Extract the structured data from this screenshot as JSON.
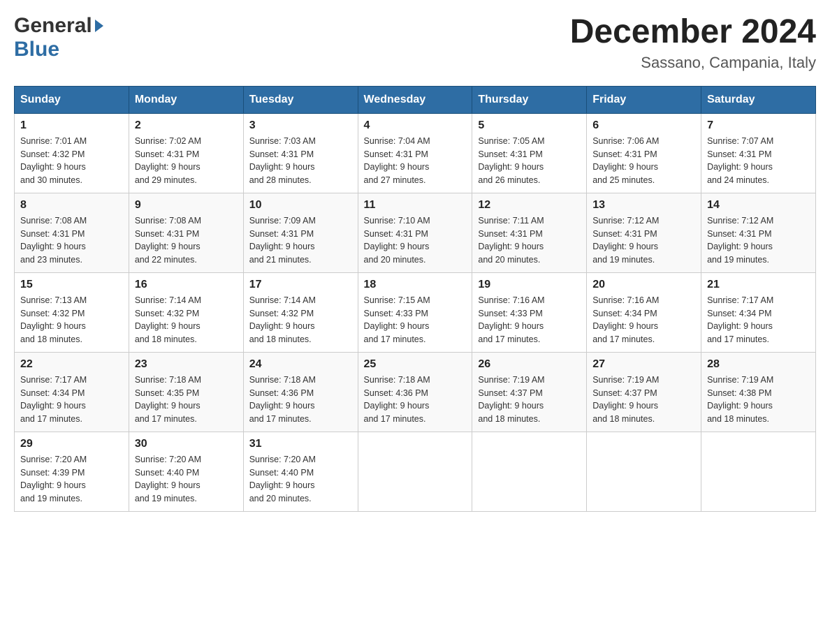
{
  "header": {
    "logo": {
      "general": "General",
      "blue": "Blue",
      "arrow": "▶"
    },
    "title": "December 2024",
    "subtitle": "Sassano, Campania, Italy"
  },
  "weekdays": [
    "Sunday",
    "Monday",
    "Tuesday",
    "Wednesday",
    "Thursday",
    "Friday",
    "Saturday"
  ],
  "weeks": [
    [
      {
        "day": "1",
        "sunrise": "7:01 AM",
        "sunset": "4:32 PM",
        "daylight": "9 hours and 30 minutes."
      },
      {
        "day": "2",
        "sunrise": "7:02 AM",
        "sunset": "4:31 PM",
        "daylight": "9 hours and 29 minutes."
      },
      {
        "day": "3",
        "sunrise": "7:03 AM",
        "sunset": "4:31 PM",
        "daylight": "9 hours and 28 minutes."
      },
      {
        "day": "4",
        "sunrise": "7:04 AM",
        "sunset": "4:31 PM",
        "daylight": "9 hours and 27 minutes."
      },
      {
        "day": "5",
        "sunrise": "7:05 AM",
        "sunset": "4:31 PM",
        "daylight": "9 hours and 26 minutes."
      },
      {
        "day": "6",
        "sunrise": "7:06 AM",
        "sunset": "4:31 PM",
        "daylight": "9 hours and 25 minutes."
      },
      {
        "day": "7",
        "sunrise": "7:07 AM",
        "sunset": "4:31 PM",
        "daylight": "9 hours and 24 minutes."
      }
    ],
    [
      {
        "day": "8",
        "sunrise": "7:08 AM",
        "sunset": "4:31 PM",
        "daylight": "9 hours and 23 minutes."
      },
      {
        "day": "9",
        "sunrise": "7:08 AM",
        "sunset": "4:31 PM",
        "daylight": "9 hours and 22 minutes."
      },
      {
        "day": "10",
        "sunrise": "7:09 AM",
        "sunset": "4:31 PM",
        "daylight": "9 hours and 21 minutes."
      },
      {
        "day": "11",
        "sunrise": "7:10 AM",
        "sunset": "4:31 PM",
        "daylight": "9 hours and 20 minutes."
      },
      {
        "day": "12",
        "sunrise": "7:11 AM",
        "sunset": "4:31 PM",
        "daylight": "9 hours and 20 minutes."
      },
      {
        "day": "13",
        "sunrise": "7:12 AM",
        "sunset": "4:31 PM",
        "daylight": "9 hours and 19 minutes."
      },
      {
        "day": "14",
        "sunrise": "7:12 AM",
        "sunset": "4:31 PM",
        "daylight": "9 hours and 19 minutes."
      }
    ],
    [
      {
        "day": "15",
        "sunrise": "7:13 AM",
        "sunset": "4:32 PM",
        "daylight": "9 hours and 18 minutes."
      },
      {
        "day": "16",
        "sunrise": "7:14 AM",
        "sunset": "4:32 PM",
        "daylight": "9 hours and 18 minutes."
      },
      {
        "day": "17",
        "sunrise": "7:14 AM",
        "sunset": "4:32 PM",
        "daylight": "9 hours and 18 minutes."
      },
      {
        "day": "18",
        "sunrise": "7:15 AM",
        "sunset": "4:33 PM",
        "daylight": "9 hours and 17 minutes."
      },
      {
        "day": "19",
        "sunrise": "7:16 AM",
        "sunset": "4:33 PM",
        "daylight": "9 hours and 17 minutes."
      },
      {
        "day": "20",
        "sunrise": "7:16 AM",
        "sunset": "4:34 PM",
        "daylight": "9 hours and 17 minutes."
      },
      {
        "day": "21",
        "sunrise": "7:17 AM",
        "sunset": "4:34 PM",
        "daylight": "9 hours and 17 minutes."
      }
    ],
    [
      {
        "day": "22",
        "sunrise": "7:17 AM",
        "sunset": "4:34 PM",
        "daylight": "9 hours and 17 minutes."
      },
      {
        "day": "23",
        "sunrise": "7:18 AM",
        "sunset": "4:35 PM",
        "daylight": "9 hours and 17 minutes."
      },
      {
        "day": "24",
        "sunrise": "7:18 AM",
        "sunset": "4:36 PM",
        "daylight": "9 hours and 17 minutes."
      },
      {
        "day": "25",
        "sunrise": "7:18 AM",
        "sunset": "4:36 PM",
        "daylight": "9 hours and 17 minutes."
      },
      {
        "day": "26",
        "sunrise": "7:19 AM",
        "sunset": "4:37 PM",
        "daylight": "9 hours and 18 minutes."
      },
      {
        "day": "27",
        "sunrise": "7:19 AM",
        "sunset": "4:37 PM",
        "daylight": "9 hours and 18 minutes."
      },
      {
        "day": "28",
        "sunrise": "7:19 AM",
        "sunset": "4:38 PM",
        "daylight": "9 hours and 18 minutes."
      }
    ],
    [
      {
        "day": "29",
        "sunrise": "7:20 AM",
        "sunset": "4:39 PM",
        "daylight": "9 hours and 19 minutes."
      },
      {
        "day": "30",
        "sunrise": "7:20 AM",
        "sunset": "4:40 PM",
        "daylight": "9 hours and 19 minutes."
      },
      {
        "day": "31",
        "sunrise": "7:20 AM",
        "sunset": "4:40 PM",
        "daylight": "9 hours and 20 minutes."
      },
      null,
      null,
      null,
      null
    ]
  ],
  "labels": {
    "sunrise": "Sunrise:",
    "sunset": "Sunset:",
    "daylight": "Daylight:"
  }
}
